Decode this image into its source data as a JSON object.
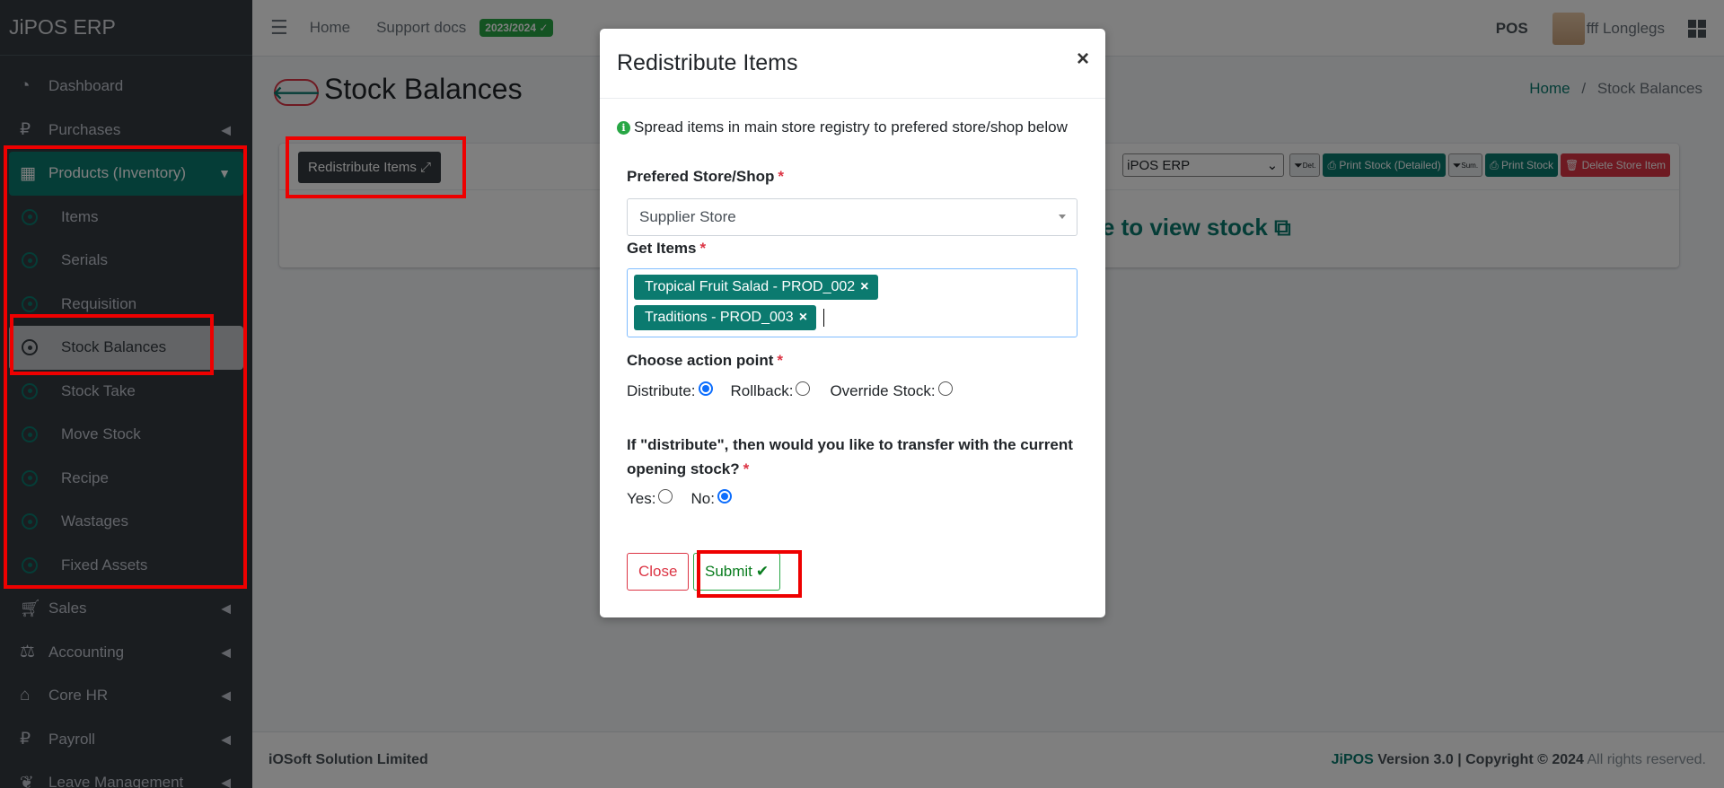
{
  "app": {
    "brand": "JiPOS ERP"
  },
  "sidebar": {
    "items": [
      {
        "label": "Dashboard",
        "icon": "tachometer-icon"
      },
      {
        "label": "Purchases",
        "icon": "ruble-icon"
      },
      {
        "label": "Products (Inventory)",
        "icon": "table-icon"
      },
      {
        "label": "Items"
      },
      {
        "label": "Serials"
      },
      {
        "label": "Requisition"
      },
      {
        "label": "Stock Balances"
      },
      {
        "label": "Stock Take"
      },
      {
        "label": "Move Stock"
      },
      {
        "label": "Recipe"
      },
      {
        "label": "Wastages"
      },
      {
        "label": "Fixed Assets"
      },
      {
        "label": "Sales",
        "icon": "cart-icon"
      },
      {
        "label": "Accounting",
        "icon": "scale-icon"
      },
      {
        "label": "Core HR",
        "icon": "bank-icon"
      },
      {
        "label": "Payroll",
        "icon": "ruble-icon"
      },
      {
        "label": "Leave Management",
        "icon": "leaf-icon"
      }
    ]
  },
  "topbar": {
    "home": "Home",
    "support": "Support docs",
    "year_badge": "2023/2024 ✓",
    "pos": "POS",
    "user": "fff Longlegs"
  },
  "page": {
    "title": "Stock Balances",
    "breadcrumb_home": "Home",
    "breadcrumb_sep": "/",
    "breadcrumb_current": "Stock Balances"
  },
  "card": {
    "redistribute_label": "Redistribute Items ⤢",
    "store_select": "iPOS ERP",
    "det_btn": "Det.",
    "print_detailed": "Print Stock (Detailed)",
    "sum_btn": "Sum.",
    "print_stock": "Print Stock",
    "delete_item": "Delete Store Item",
    "view_link": "ge to view stock ⧉"
  },
  "modal": {
    "title": "Redistribute Items",
    "close_x": "×",
    "info": "Spread items in main store registry to prefered store/shop below",
    "store_label": "Prefered Store/Shop",
    "store_value": "Supplier Store",
    "items_label": "Get Items",
    "tags": [
      "Tropical Fruit Salad - PROD_002",
      "Traditions - PROD_003"
    ],
    "action_label": "Choose action point",
    "actions": [
      {
        "label": "Distribute:",
        "checked": true
      },
      {
        "label": "Rollback:",
        "checked": false
      },
      {
        "label": "Override Stock:",
        "checked": false
      }
    ],
    "question": "If \"distribute\", then would you like to transfer with the current opening stock?",
    "yesno": [
      {
        "label": "Yes:",
        "checked": false
      },
      {
        "label": "No:",
        "checked": true
      }
    ],
    "close_btn": "Close",
    "submit_btn": "Submit"
  },
  "footer": {
    "company": "iOSoft Solution Limited",
    "product": "JiPOS",
    "version": "Version 3.0 | Copyright © 2024",
    "rights": "All rights reserved."
  },
  "colors": {
    "accent": "#0b7a6f",
    "danger": "#dc3545",
    "success": "#28a745",
    "sidebar": "#343a40",
    "highlight": "#ee0000"
  }
}
